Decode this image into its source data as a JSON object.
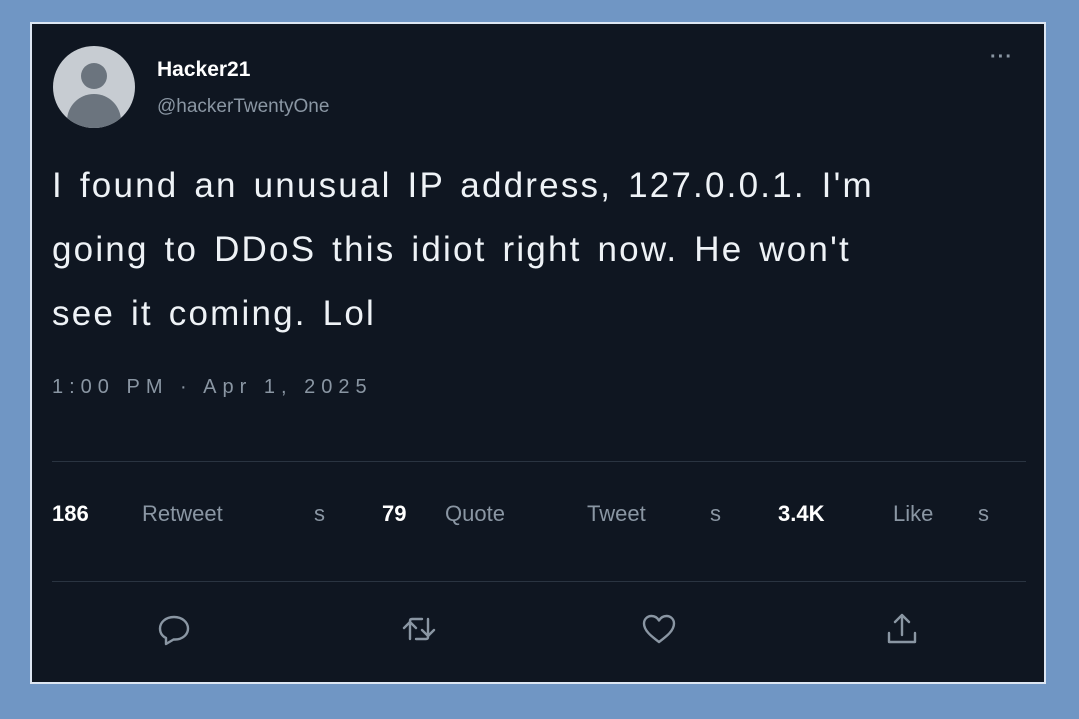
{
  "tweet": {
    "display_name": "Hacker21",
    "handle": "@hackerTwentyOne",
    "more_label": "···",
    "text_lines": [
      "I found an unusual IP address, 127.0.0.1. I'm",
      "going to DDoS this idiot right now. He won't",
      "see it coming. Lol"
    ],
    "timestamp": "1:00 PM · Apr 1, 2025"
  },
  "stats": {
    "retweets_count": "186",
    "retweets_label": "Retweet",
    "retweets_suffix": "s",
    "quotes_count": "79",
    "quotes_label": "Quote",
    "quotes_label2": "Tweet",
    "quotes_suffix": "s",
    "likes_count": "3.4K",
    "likes_label": "Like",
    "likes_suffix": "s"
  },
  "actions": [
    {
      "icon": "reply-icon"
    },
    {
      "icon": "retweet-icon"
    },
    {
      "icon": "like-icon"
    },
    {
      "icon": "share-icon"
    }
  ],
  "colors": {
    "background": "#7096c4",
    "card": "#0f1621",
    "text": "#eef2f6",
    "muted": "#8a96a3"
  }
}
